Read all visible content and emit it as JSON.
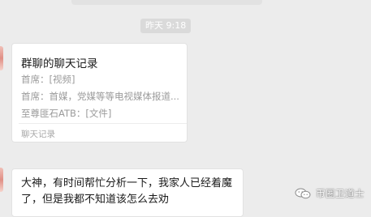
{
  "timestamp": "昨天 9:18",
  "chat_record_card": {
    "title": "群聊的聊天记录",
    "lines": [
      "首席：[视频]",
      "首席：首媒，党媒等等电视媒体报道...",
      "至尊匪石ATB：[文件]"
    ],
    "footer": "聊天记录"
  },
  "message": {
    "text": "大神，有时间帮忙分析一下，我家人已经着魔了，但是我都不知道该怎么去劝"
  },
  "watermark": {
    "text": "币圈卫道士",
    "icon": "wechat-icon"
  },
  "colors": {
    "background": "#ececec",
    "bubble": "#ffffff",
    "timestamp_bg": "#dadada",
    "secondary_text": "#9b9b9b"
  }
}
